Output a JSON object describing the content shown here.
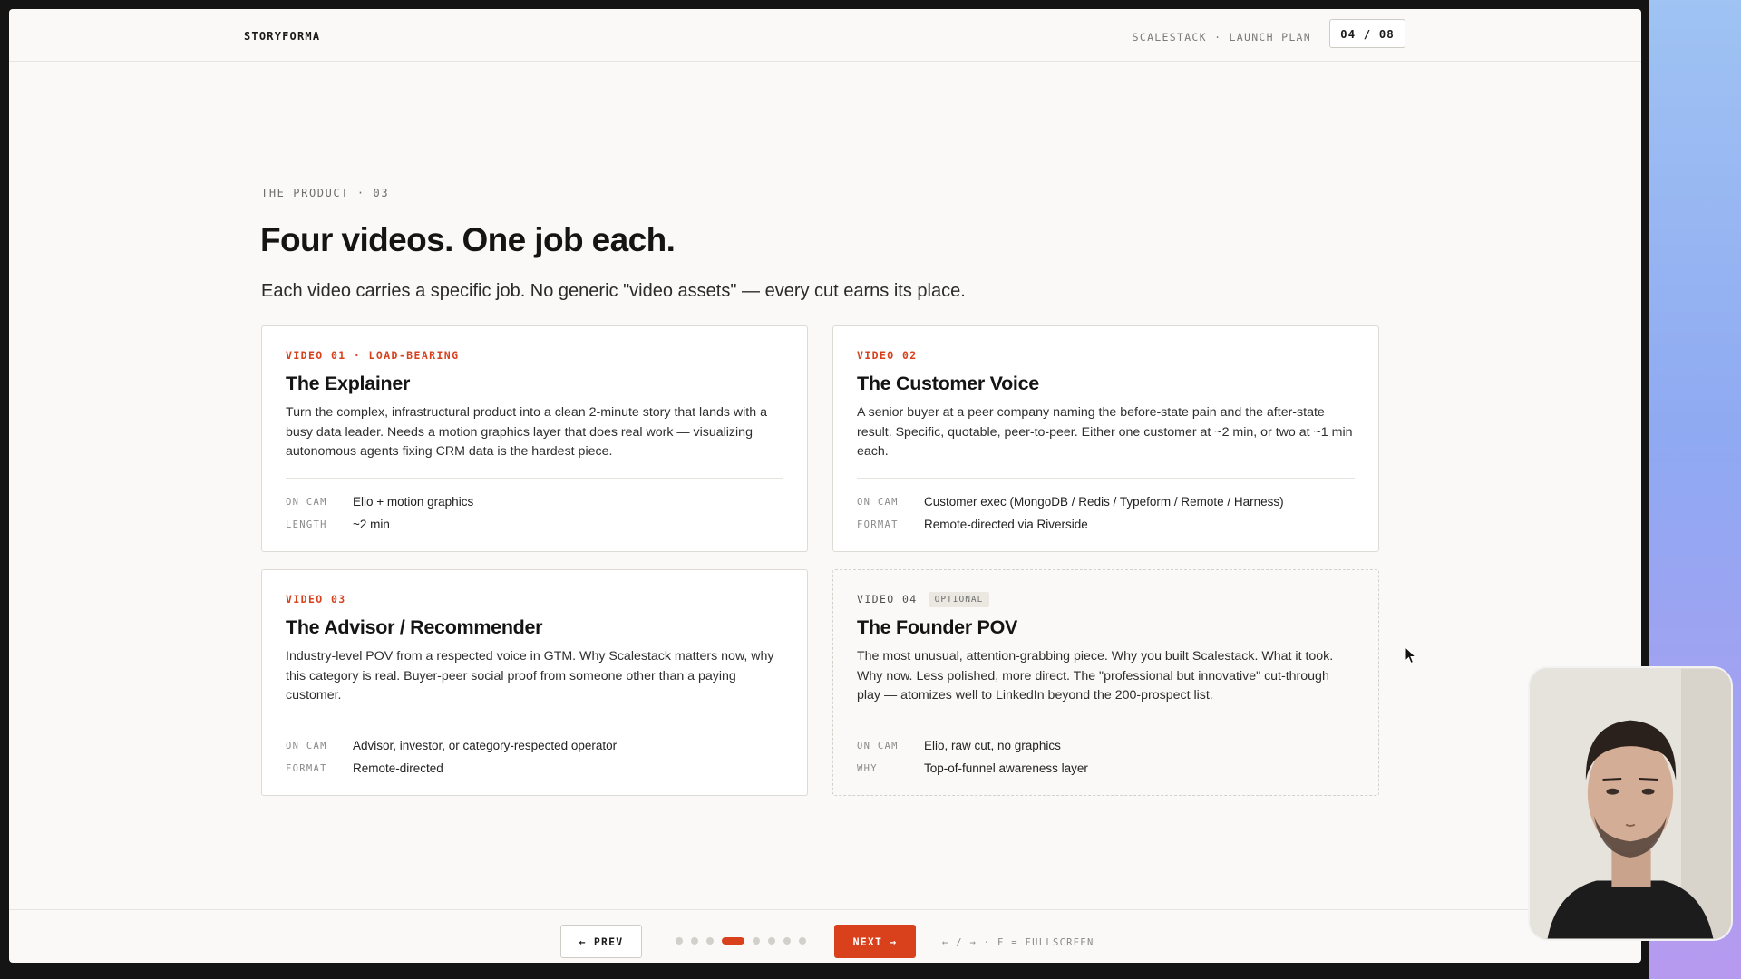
{
  "header": {
    "brand": "STORYFORMA",
    "deck_title": "SCALESTACK · LAUNCH PLAN",
    "slide_counter": "04 / 08"
  },
  "slide": {
    "eyebrow": "THE PRODUCT · 03",
    "headline": "Four videos. One job each.",
    "subhead": "Each video carries a specific job. No generic \"video assets\" — every cut earns its place."
  },
  "cards": [
    {
      "tag": "VIDEO 01 · LOAD-BEARING",
      "title": "The Explainer",
      "description": "Turn the complex, infrastructural product into a clean 2-minute story that lands with a busy data leader. Needs a motion graphics layer that does real work — visualizing autonomous agents fixing CRM data is the hardest piece.",
      "meta": [
        {
          "key": "ON CAM",
          "value": "Elio + motion graphics"
        },
        {
          "key": "LENGTH",
          "value": "~2 min"
        }
      ]
    },
    {
      "tag": "VIDEO 02",
      "title": "The Customer Voice",
      "description": "A senior buyer at a peer company naming the before-state pain and the after-state result. Specific, quotable, peer-to-peer. Either one customer at ~2 min, or two at ~1 min each.",
      "meta": [
        {
          "key": "ON CAM",
          "value": "Customer exec (MongoDB / Redis / Typeform / Remote / Harness)"
        },
        {
          "key": "FORMAT",
          "value": "Remote-directed via Riverside"
        }
      ]
    },
    {
      "tag": "VIDEO 03",
      "title": "The Advisor / Recommender",
      "description": "Industry-level POV from a respected voice in GTM. Why Scalestack matters now, why this category is real. Buyer-peer social proof from someone other than a paying customer.",
      "meta": [
        {
          "key": "ON CAM",
          "value": "Advisor, investor, or category-respected operator"
        },
        {
          "key": "FORMAT",
          "value": "Remote-directed"
        }
      ]
    },
    {
      "tag": "VIDEO 04",
      "badge": "OPTIONAL",
      "title": "The Founder POV",
      "description": "The most unusual, attention-grabbing piece. Why you built Scalestack. What it took. Why now. Less polished, more direct. The \"professional but innovative\" cut-through play — atomizes well to LinkedIn beyond the 200-prospect list.",
      "meta": [
        {
          "key": "ON CAM",
          "value": "Elio, raw cut, no graphics"
        },
        {
          "key": "WHY",
          "value": "Top-of-funnel awareness layer"
        }
      ]
    }
  ],
  "footer": {
    "prev_label": "← PREV",
    "next_label": "NEXT →",
    "total_dots": 8,
    "active_dot": 4,
    "keyboard_hint": "← / → · F = FULLSCREEN"
  },
  "colors": {
    "accent": "#d9401c",
    "background": "#faf9f7",
    "text": "#141414"
  },
  "icons": [
    "cursor-icon"
  ]
}
